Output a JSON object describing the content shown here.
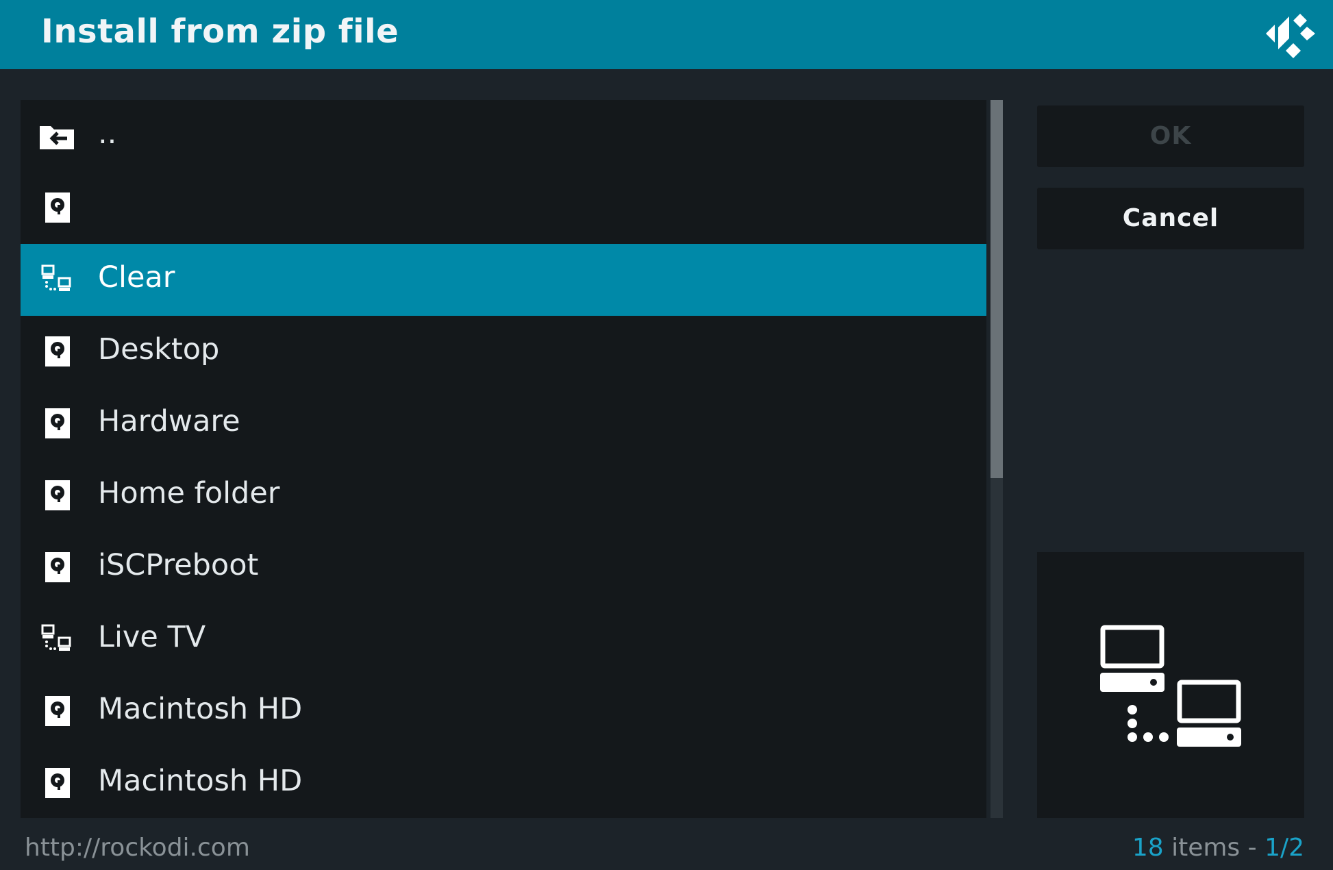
{
  "header": {
    "title": "Install from zip file",
    "logo_icon": "kodi-logo-icon"
  },
  "file_list": {
    "items": [
      {
        "label": "..",
        "icon": "folder-back-icon"
      },
      {
        "label": "",
        "icon": "hard-drive-icon"
      },
      {
        "label": "Clear",
        "icon": "network-icon",
        "selected": true
      },
      {
        "label": "Desktop",
        "icon": "hard-drive-icon"
      },
      {
        "label": "Hardware",
        "icon": "hard-drive-icon"
      },
      {
        "label": "Home folder",
        "icon": "hard-drive-icon"
      },
      {
        "label": "iSCPreboot",
        "icon": "hard-drive-icon"
      },
      {
        "label": "Live TV",
        "icon": "network-icon"
      },
      {
        "label": "Macintosh HD",
        "icon": "hard-drive-icon"
      },
      {
        "label": "Macintosh HD",
        "icon": "hard-drive-icon"
      }
    ]
  },
  "buttons": {
    "ok_label": "OK",
    "cancel_label": "Cancel"
  },
  "preview": {
    "icon": "network-computers-icon"
  },
  "footer": {
    "watermark": "http://rockodi.com",
    "item_count": "18",
    "items_word": " items - ",
    "page": "1/2"
  },
  "colors": {
    "header_bg": "#00809c",
    "selected_bg": "#0089a8",
    "panel_bg": "#14181b",
    "page_bg": "#1c2329",
    "accent_text": "#1aa3c9"
  }
}
